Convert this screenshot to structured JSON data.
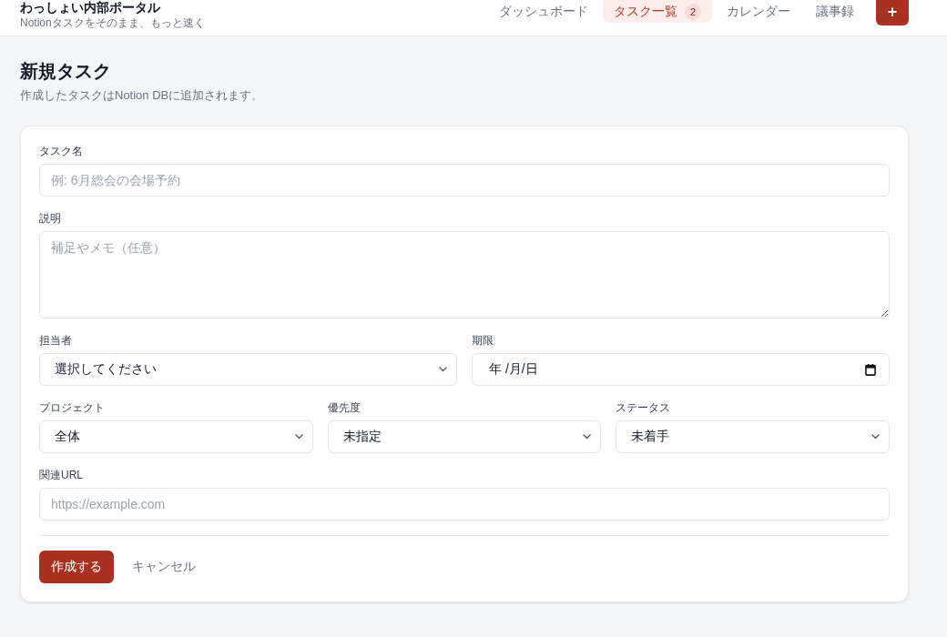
{
  "header": {
    "title": "わっしょい内部ポータル",
    "subtitle": "Notionタスクをそのまま、もっと速く",
    "nav": [
      {
        "label": "ダッシュボード",
        "selected": false
      },
      {
        "label": "タスク一覧",
        "selected": true,
        "badge": "2"
      },
      {
        "label": "カレンダー",
        "selected": false
      },
      {
        "label": "議事録",
        "selected": false
      }
    ],
    "add_button": "+"
  },
  "page": {
    "title": "新規タスク",
    "subtitle": "作成したタスクはNotion DBに追加されます。"
  },
  "form": {
    "rows": [
      {
        "fields": [
          {
            "kind": "text",
            "label": "タスク名",
            "placeholder": "例: 6月総会の会場予約"
          }
        ]
      },
      {
        "fields": [
          {
            "kind": "textarea",
            "label": "説明",
            "placeholder": "補足やメモ（任意）"
          }
        ]
      },
      {
        "fields": [
          {
            "kind": "select",
            "label": "担当者",
            "value": "選択してください"
          },
          {
            "kind": "date",
            "label": "期限",
            "placeholder": "年 /月/日"
          }
        ]
      },
      {
        "fields": [
          {
            "kind": "select",
            "label": "プロジェクト",
            "value": "全体"
          },
          {
            "kind": "select",
            "label": "優先度",
            "value": "未指定"
          },
          {
            "kind": "select",
            "label": "ステータス",
            "value": "未着手"
          }
        ]
      },
      {
        "fields": [
          {
            "kind": "text",
            "label": "関連URL",
            "placeholder": "https://example.com"
          }
        ]
      }
    ],
    "actions": [
      {
        "kind": "primary",
        "label": "作成する"
      },
      {
        "kind": "plain",
        "label": "キャンセル"
      }
    ]
  }
}
